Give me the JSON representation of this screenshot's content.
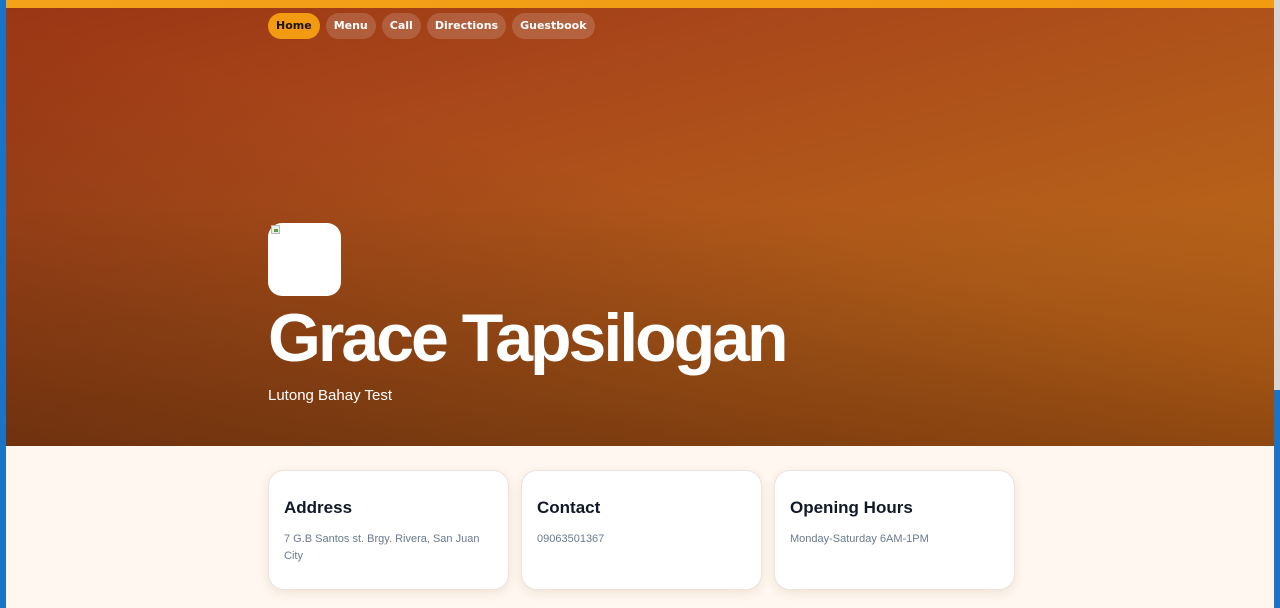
{
  "nav": {
    "items": [
      {
        "label": "Home"
      },
      {
        "label": "Menu"
      },
      {
        "label": "Call"
      },
      {
        "label": "Directions"
      },
      {
        "label": "Guestbook"
      }
    ]
  },
  "hero": {
    "title": "Grace Tapsilogan",
    "subtitle": "Lutong Bahay Test"
  },
  "cards": [
    {
      "title": "Address",
      "text": "7 G.B Santos st. Brgy. Rivera, San Juan City"
    },
    {
      "title": "Contact",
      "text": "09063501367"
    },
    {
      "title": "Opening Hours",
      "text": "Monday-Saturday 6AM-1PM"
    }
  ],
  "colors": {
    "accent": "#f29a12",
    "hero_start": "#9a3614",
    "hero_end": "#c66a17",
    "page_bg": "#fff7f0"
  },
  "icons": {
    "logo": "broken-image-icon"
  }
}
